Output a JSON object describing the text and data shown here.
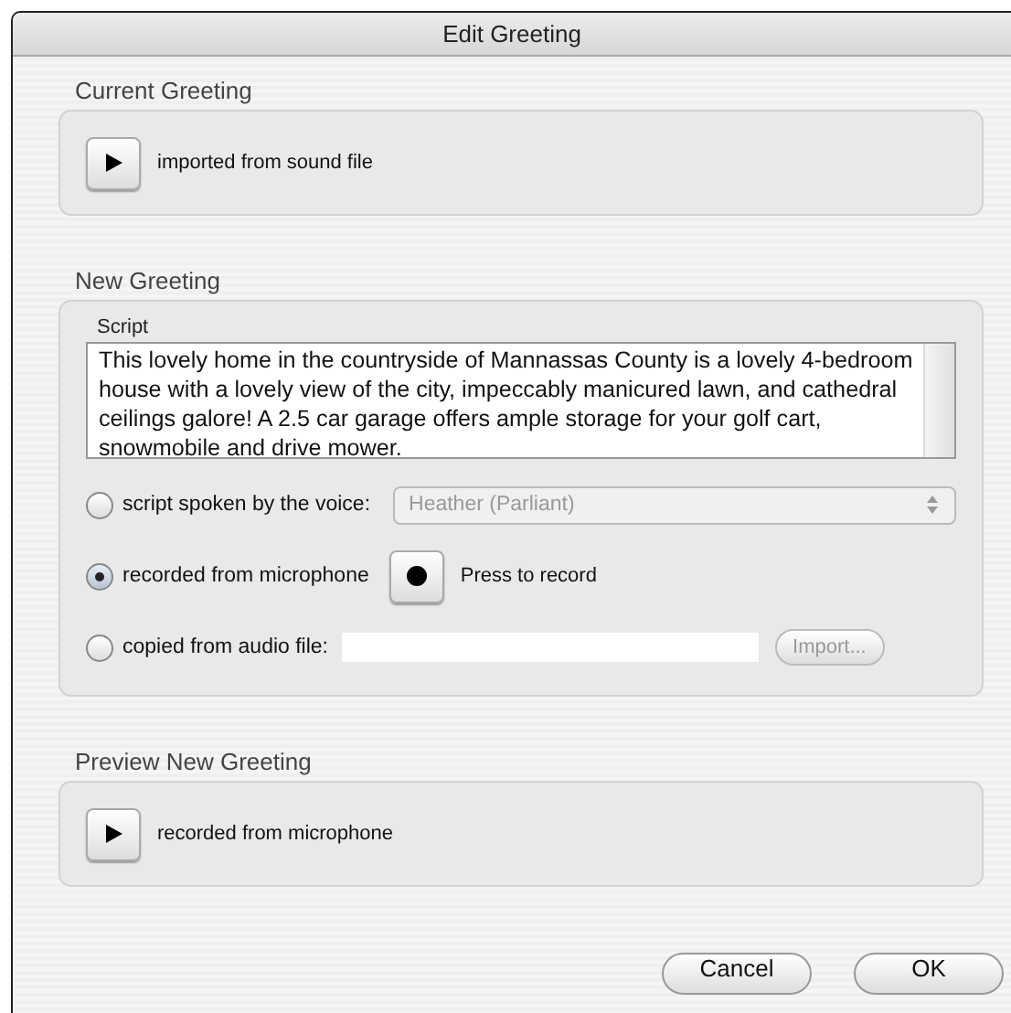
{
  "window": {
    "title": "Edit Greeting"
  },
  "current_greeting": {
    "heading": "Current Greeting",
    "play_label": "imported from sound file"
  },
  "new_greeting": {
    "heading": "New Greeting",
    "script_label": "Script",
    "script_text": "This lovely home in the countryside of Mannassas County is a lovely 4-bedroom house with a lovely view of the city, impeccably manicured lawn, and cathedral ceilings galore!  A 2.5 car garage offers ample storage for your golf cart, snowmobile and drive mower.",
    "options": [
      {
        "kind": "voice",
        "label": "script spoken by the voice:",
        "selected": false,
        "voice": "Heather (Parliant)",
        "disabled": true
      },
      {
        "kind": "record",
        "label": "recorded from microphone",
        "selected": true,
        "record_label": "Press to record"
      },
      {
        "kind": "file",
        "label": "copied from audio file:",
        "selected": false,
        "import_button": "Import...",
        "disabled": true
      }
    ]
  },
  "preview": {
    "heading": "Preview New Greeting",
    "play_label": "recorded from microphone"
  },
  "buttons": [
    "Cancel",
    "OK"
  ]
}
